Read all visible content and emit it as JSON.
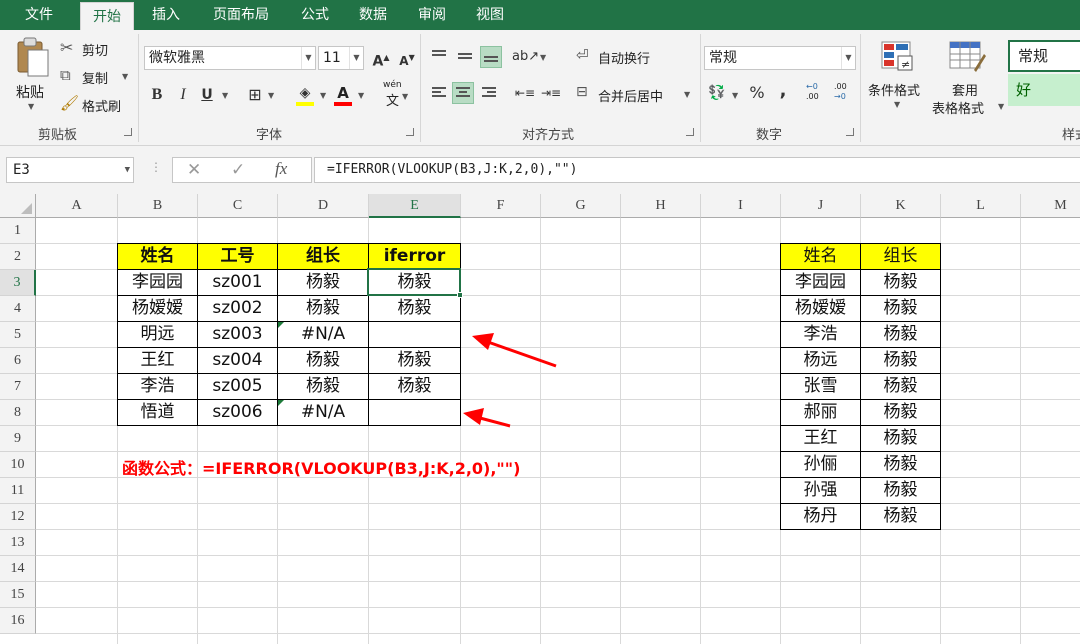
{
  "tabs": [
    "文件",
    "开始",
    "插入",
    "页面布局",
    "公式",
    "数据",
    "审阅",
    "视图"
  ],
  "ribbon": {
    "clipboard": {
      "paste": "粘贴",
      "cut": "剪切",
      "copy": "复制",
      "format_painter": "格式刷",
      "label": "剪贴板"
    },
    "font": {
      "name": "微软雅黑",
      "size": "11",
      "bold": "B",
      "italic": "I",
      "underline": "U",
      "grow": "A",
      "shrink": "A",
      "label": "字体",
      "wen": "wén",
      "wen_char": "文"
    },
    "alignment": {
      "wrap": "自动换行",
      "merge": "合并后居中",
      "label": "对齐方式"
    },
    "number": {
      "format": "常规",
      "percent": "%",
      "comma": ",",
      "inc_decimal": ".00",
      "dec_decimal": ".00",
      "label": "数字"
    },
    "styles": {
      "cond_format": "条件格式",
      "table_format_1": "套用",
      "table_format_2": "表格格式",
      "style_normal": "常规",
      "style_good": "好",
      "label": "样式"
    }
  },
  "formula_bar": {
    "name_box": "E3",
    "cancel": "✕",
    "enter": "✓",
    "fx": "fx",
    "formula": "=IFERROR(VLOOKUP(B3,J:K,2,0),\"\")"
  },
  "columns": [
    "A",
    "B",
    "C",
    "D",
    "E",
    "F",
    "G",
    "H",
    "I",
    "J",
    "K",
    "L",
    "M"
  ],
  "selected_column": "E",
  "rows": [
    "1",
    "2",
    "3",
    "4",
    "5",
    "6",
    "7",
    "8",
    "9",
    "10",
    "11",
    "12",
    "13",
    "14",
    "15",
    "16"
  ],
  "selected_row": "3",
  "left_table": {
    "headers": [
      "姓名",
      "工号",
      "组长",
      "iferror"
    ],
    "rows": [
      [
        "李园园",
        "sz001",
        "杨毅",
        "杨毅"
      ],
      [
        "杨嫒嫒",
        "sz002",
        "杨毅",
        "杨毅"
      ],
      [
        "明远",
        "sz003",
        "#N/A",
        ""
      ],
      [
        "王红",
        "sz004",
        "杨毅",
        "杨毅"
      ],
      [
        "李浩",
        "sz005",
        "杨毅",
        "杨毅"
      ],
      [
        "悟道",
        "sz006",
        "#N/A",
        ""
      ]
    ]
  },
  "right_table": {
    "headers": [
      "姓名",
      "组长"
    ],
    "rows": [
      [
        "李园园",
        "杨毅"
      ],
      [
        "杨嫒嫒",
        "杨毅"
      ],
      [
        "李浩",
        "杨毅"
      ],
      [
        "杨远",
        "杨毅"
      ],
      [
        "张雪",
        "杨毅"
      ],
      [
        "郝丽",
        "杨毅"
      ],
      [
        "王红",
        "杨毅"
      ],
      [
        "孙俪",
        "杨毅"
      ],
      [
        "孙强",
        "杨毅"
      ],
      [
        "杨丹",
        "杨毅"
      ]
    ]
  },
  "note": "函数公式：=IFERROR(VLOOKUP(B3,J:K,2,0),\"\")",
  "colors": {
    "excel_green": "#217346",
    "header_fill": "#ffff00",
    "note": "#ff0000",
    "arrow": "#ff0000"
  }
}
